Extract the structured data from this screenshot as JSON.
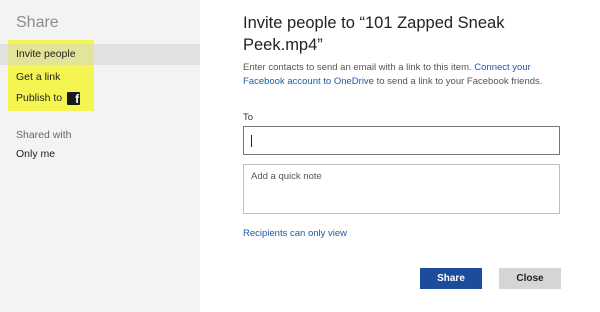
{
  "sidebar": {
    "title": "Share",
    "nav": [
      {
        "label": "Invite people"
      },
      {
        "label": "Get a link"
      },
      {
        "label": "Publish to"
      }
    ],
    "publish_icon": "facebook-icon",
    "publish_icon_glyph": "f",
    "shared_with_label": "Shared with",
    "shared_with_value": "Only me"
  },
  "main": {
    "title": "Invite people to “101 Zapped Sneak Peek.mp4”",
    "description": "Enter contacts to send an email with a link to this item.",
    "connect_link": "Connect your Facebook account to OneDrive",
    "description_suffix": "to send a link to your Facebook friends.",
    "to_label": "To",
    "to_value": "",
    "note_placeholder": "Add a quick note",
    "recipients_link": "Recipients can only view"
  },
  "buttons": {
    "share": "Share",
    "close": "Close"
  },
  "colors": {
    "sidebar_bg": "#f3f3f3",
    "highlight": "#f5f552",
    "link": "#1a5ba8",
    "primary_button": "#1c4d9c",
    "secondary_button": "#d5d5d5"
  }
}
